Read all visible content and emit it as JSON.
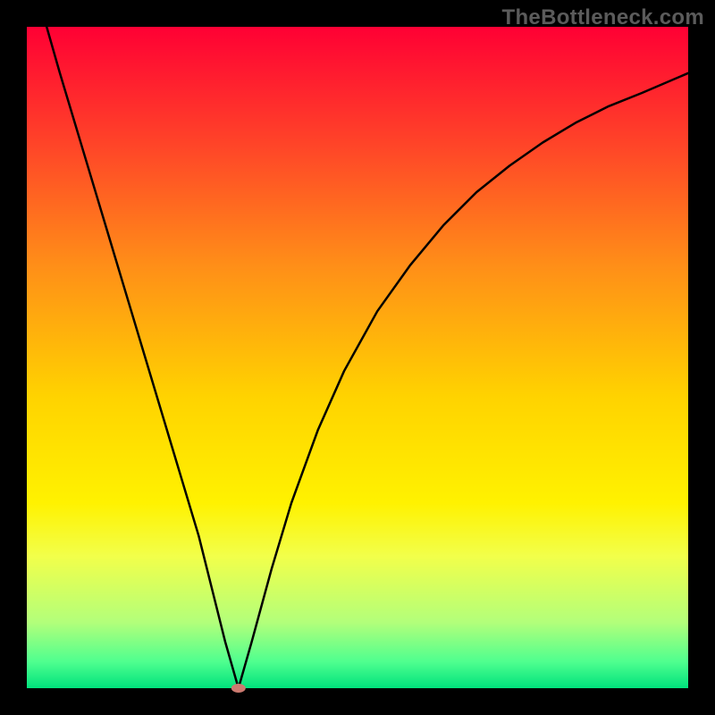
{
  "watermark": "TheBottleneck.com",
  "chart_data": {
    "type": "line",
    "title": "",
    "xlabel": "",
    "ylabel": "",
    "x_range": [
      0,
      100
    ],
    "y_range": [
      0,
      100
    ],
    "minimum_marker": {
      "x": 32,
      "y": 0,
      "rx": 8,
      "ry": 5,
      "color": "#cc7a70"
    },
    "curve": [
      {
        "x": 3,
        "y": 100
      },
      {
        "x": 5,
        "y": 93
      },
      {
        "x": 8,
        "y": 83
      },
      {
        "x": 11,
        "y": 73
      },
      {
        "x": 14,
        "y": 63
      },
      {
        "x": 17,
        "y": 53
      },
      {
        "x": 20,
        "y": 43
      },
      {
        "x": 23,
        "y": 33
      },
      {
        "x": 26,
        "y": 23
      },
      {
        "x": 28,
        "y": 15
      },
      {
        "x": 30,
        "y": 7
      },
      {
        "x": 32,
        "y": 0
      },
      {
        "x": 34,
        "y": 7
      },
      {
        "x": 37,
        "y": 18
      },
      {
        "x": 40,
        "y": 28
      },
      {
        "x": 44,
        "y": 39
      },
      {
        "x": 48,
        "y": 48
      },
      {
        "x": 53,
        "y": 57
      },
      {
        "x": 58,
        "y": 64
      },
      {
        "x": 63,
        "y": 70
      },
      {
        "x": 68,
        "y": 75
      },
      {
        "x": 73,
        "y": 79
      },
      {
        "x": 78,
        "y": 82.5
      },
      {
        "x": 83,
        "y": 85.5
      },
      {
        "x": 88,
        "y": 88
      },
      {
        "x": 93,
        "y": 90
      },
      {
        "x": 100,
        "y": 93
      }
    ],
    "gradient_colors": {
      "top": "#ff0034",
      "mid_upper": "#ff8e18",
      "mid": "#fff200",
      "mid_lower": "#b3ff7a",
      "bottom": "#00e27c"
    }
  }
}
